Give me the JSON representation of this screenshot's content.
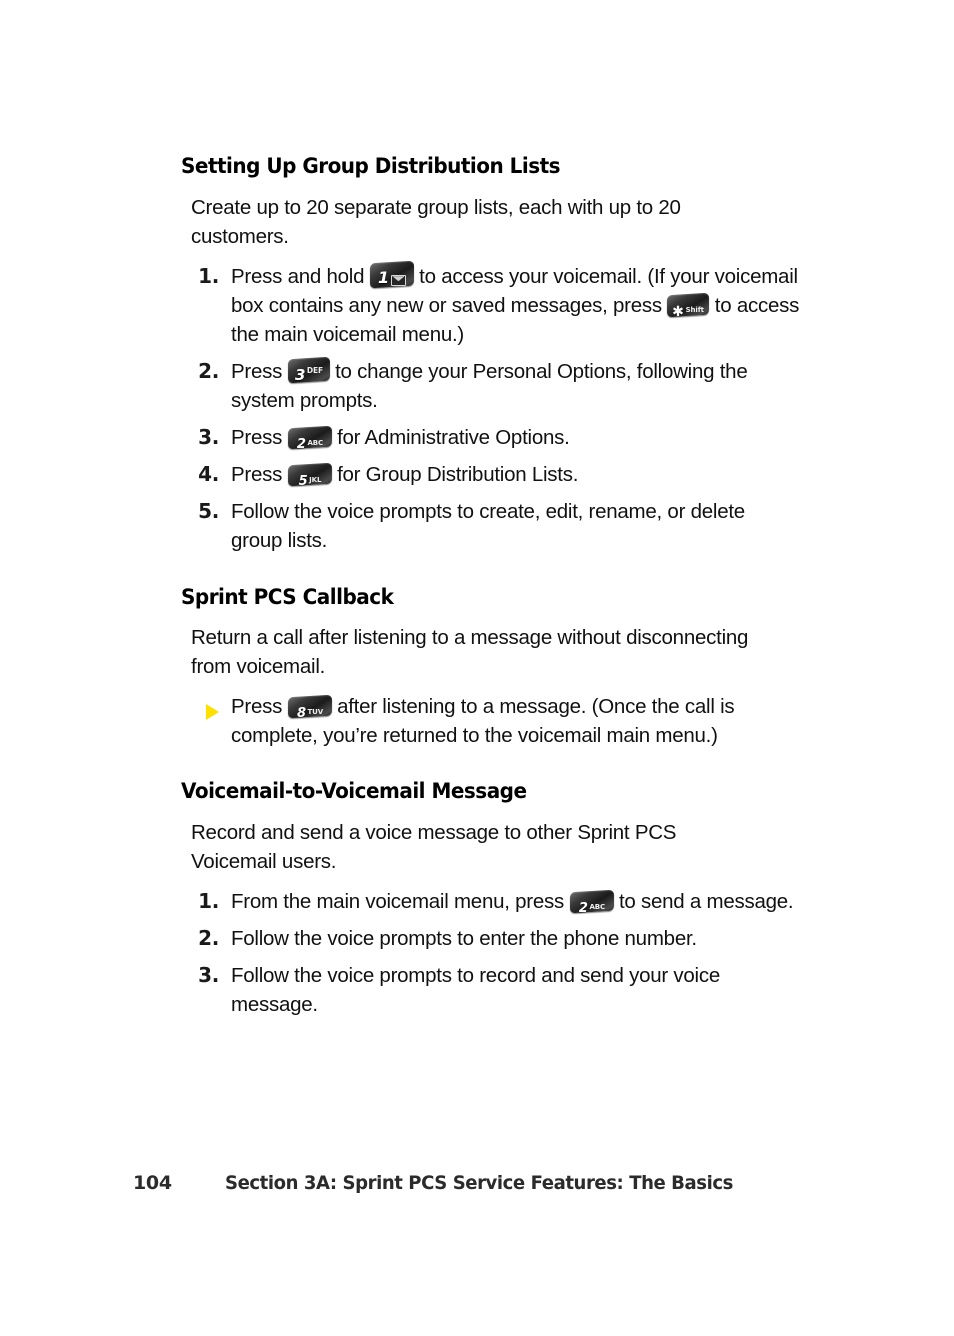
{
  "page": {
    "number": "104",
    "footer_section": "Section 3A: Sprint PCS Service Features: The Basics"
  },
  "sections": [
    {
      "heading": "Setting Up Group Distribution Lists",
      "intro": "Create up to 20 separate group lists, each with up to 20 customers.",
      "list_type": "ordered",
      "items": [
        {
          "marker": "1.",
          "text_before": "Press and hold",
          "key": {
            "name": "key-1-voicemail",
            "digit": "1",
            "sub": "envelope"
          },
          "text_after": "to access your voicemail. (If your voicemail box contains any new or saved messages, press",
          "key2": {
            "name": "key-star-shift",
            "digit": "*",
            "sub": "Shift"
          },
          "text_end": "to access the main voicemail menu.)"
        },
        {
          "marker": "2.",
          "text_before": "Press",
          "key": {
            "name": "key-3-def",
            "digit": "3",
            "sub": "DEF"
          },
          "text_after": "to change your Personal Options, following the system prompts."
        },
        {
          "marker": "3.",
          "text_before": "Press",
          "key": {
            "name": "key-2-abc",
            "digit": "2",
            "sub": "ABC"
          },
          "text_after": "for Administrative Options."
        },
        {
          "marker": "4.",
          "text_before": "Press",
          "key": {
            "name": "key-5-jkl",
            "digit": "5",
            "sub": "JKL"
          },
          "text_after": "for Group Distribution Lists."
        },
        {
          "marker": "5.",
          "text_plain": "Follow the voice prompts to create, edit, rename, or delete group lists."
        }
      ]
    },
    {
      "heading": "Sprint PCS Callback",
      "intro": "Return a call after listening to a message without disconnecting from voicemail.",
      "list_type": "bullet",
      "items": [
        {
          "marker": "▶",
          "text_before": "Press",
          "key": {
            "name": "key-8-tuv",
            "digit": "8",
            "sub": "TUV"
          },
          "text_after": "after listening to a message. (Once the call is complete, you’re returned to the voicemail main menu.)"
        }
      ]
    },
    {
      "heading": "Voicemail-to-Voicemail Message",
      "intro": "Record and send a voice message to other Sprint PCS Voicemail users.",
      "list_type": "ordered",
      "items": [
        {
          "marker": "1.",
          "text_before": "From the main voicemail menu, press",
          "key": {
            "name": "key-2-abc",
            "digit": "2",
            "sub": "ABC"
          },
          "text_after": "to send a message."
        },
        {
          "marker": "2.",
          "text_plain": "Follow the voice prompts to enter the phone number."
        },
        {
          "marker": "3.",
          "text_plain": "Follow the voice prompts to record and send your voice message."
        }
      ]
    }
  ],
  "colors": {
    "bullet_yellow": "#FFE000",
    "text": "#111111",
    "footer": "#2b2b2b",
    "key_dark": "#1b1b1b"
  }
}
